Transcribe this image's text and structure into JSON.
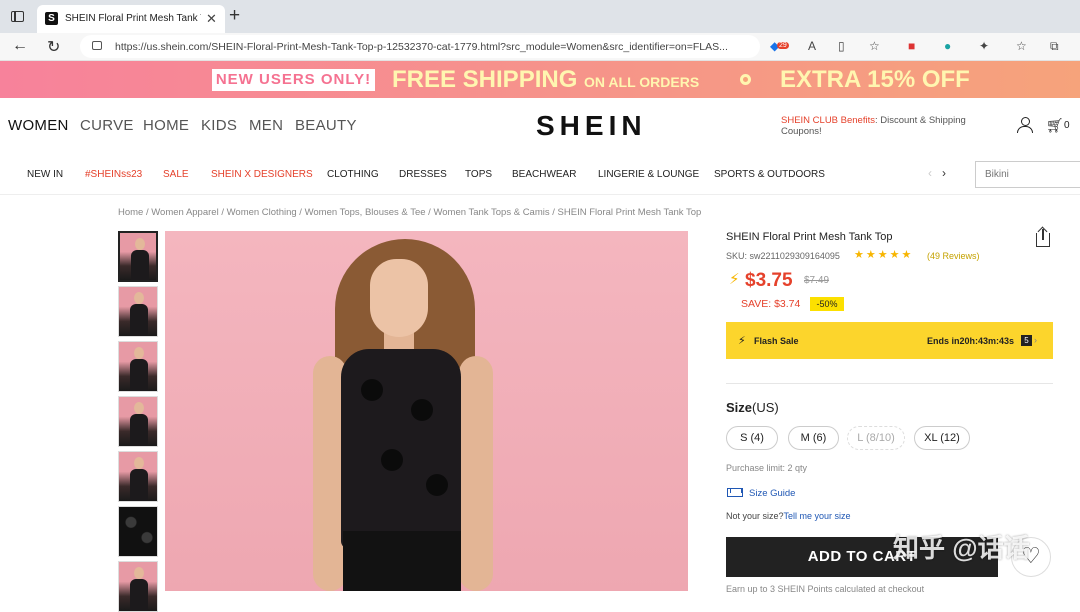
{
  "browser": {
    "tab_title": "SHEIN Floral Print Mesh Tank Top",
    "tab_favicon": "S",
    "url": "https://us.shein.com/SHEIN-Floral-Print-Mesh-Tank-Top-p-12532370-cat-1779.html?src_module=Women&src_identifier=on=FLAS...",
    "ext_badge": "29"
  },
  "promo": {
    "new_users": "NEW USERS ONLY!",
    "free_shipping": "FREE SHIPPING",
    "on_all_orders": "ON ALL ORDERS",
    "extra": "EXTRA 15% OFF"
  },
  "topnav": {
    "categories": [
      "WOMEN",
      "CURVE",
      "HOME",
      "KIDS",
      "MEN",
      "BEAUTY"
    ],
    "logo": "SHEIN",
    "club_label": "SHEIN CLUB Benefits",
    "club_text": ": Discount & Shipping Coupons!",
    "cart_count": "0"
  },
  "subnav": {
    "items": [
      "NEW IN",
      "#SHEINss23",
      "SALE",
      "SHEIN X DESIGNERS",
      "CLOTHING",
      "DRESSES",
      "TOPS",
      "BEACHWEAR",
      "LINGERIE & LOUNGE",
      "SPORTS & OUTDOORS"
    ],
    "search_placeholder": "Bikini"
  },
  "breadcrumb": [
    "Home",
    "Women Apparel",
    "Women Clothing",
    "Women Tops, Blouses & Tee",
    "Women Tank Tops & Camis",
    "SHEIN Floral Print Mesh Tank Top"
  ],
  "product": {
    "title": "SHEIN Floral Print Mesh Tank Top",
    "sku": "SKU: sw2211029309164095",
    "rating_stars": 4.5,
    "reviews": "(49 Reviews)",
    "price": "$3.75",
    "old_price": "$7.49",
    "save": "SAVE: $3.74",
    "discount": "-50%",
    "flash_label": "Flash Sale",
    "flash_ends": "Ends in20h:43m:43s",
    "flash_sec": "5",
    "size_label": "Size",
    "size_unit": "(US)",
    "sizes": [
      "S (4)",
      "M (6)",
      "L (8/10)",
      "XL (12)"
    ],
    "purchase_limit": "Purchase limit: 2 qty",
    "size_guide": "Size Guide",
    "not_sure": "Not your size?",
    "tell_me": "Tell me your size",
    "add_to_cart": "ADD TO CART",
    "points": "Earn up to 3 SHEIN Points calculated at checkout"
  },
  "watermark": "知乎 @话话"
}
